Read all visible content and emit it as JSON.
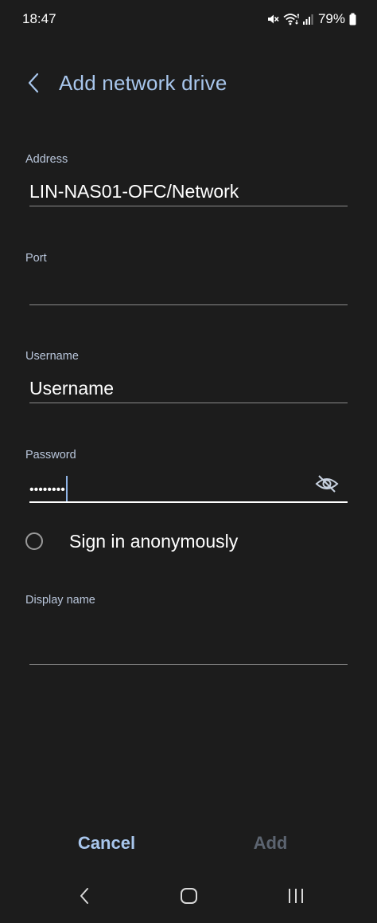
{
  "status_bar": {
    "time": "18:47",
    "battery": "79%",
    "icons": [
      "mute-icon",
      "wifi-icon",
      "signal-icon",
      "battery-icon"
    ]
  },
  "header": {
    "title": "Add network drive",
    "back_icon": "chevron-left-icon"
  },
  "form": {
    "address": {
      "label": "Address",
      "value": "LIN-NAS01-OFC/Network"
    },
    "port": {
      "label": "Port",
      "value": ""
    },
    "username": {
      "label": "Username",
      "value": "Username"
    },
    "password": {
      "label": "Password",
      "masked_value": "••••••••",
      "visibility_icon": "eye-off-icon"
    },
    "anonymous": {
      "label": "Sign in anonymously",
      "checked": false
    },
    "display_name": {
      "label": "Display name",
      "value": ""
    }
  },
  "actions": {
    "cancel_label": "Cancel",
    "add_label": "Add"
  },
  "nav_bar": {
    "icons": [
      "nav-back-icon",
      "nav-home-icon",
      "nav-recents-icon"
    ]
  },
  "colors": {
    "background": "#1c1c1c",
    "accent": "#a8c6ec",
    "label": "#b9c6db",
    "disabled": "#5c6470",
    "underline": "#8a8a8a",
    "caret": "#8fb4e6"
  }
}
